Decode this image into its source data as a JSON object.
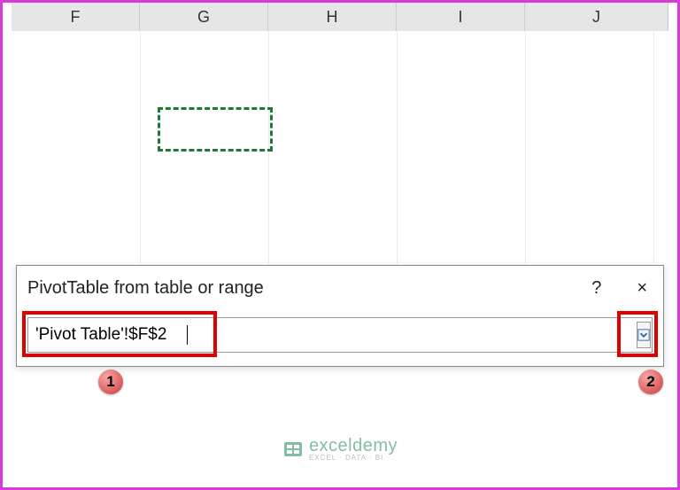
{
  "columns": [
    "F",
    "G",
    "H",
    "I",
    "J"
  ],
  "dialog": {
    "title": "PivotTable from table or range",
    "help_label": "?",
    "close_label": "×",
    "range_value": "'Pivot Table'!$F$2"
  },
  "callouts": {
    "one": "1",
    "two": "2"
  },
  "watermark": {
    "main": "exceldemy",
    "sub": "EXCEL · DATA · BI"
  }
}
